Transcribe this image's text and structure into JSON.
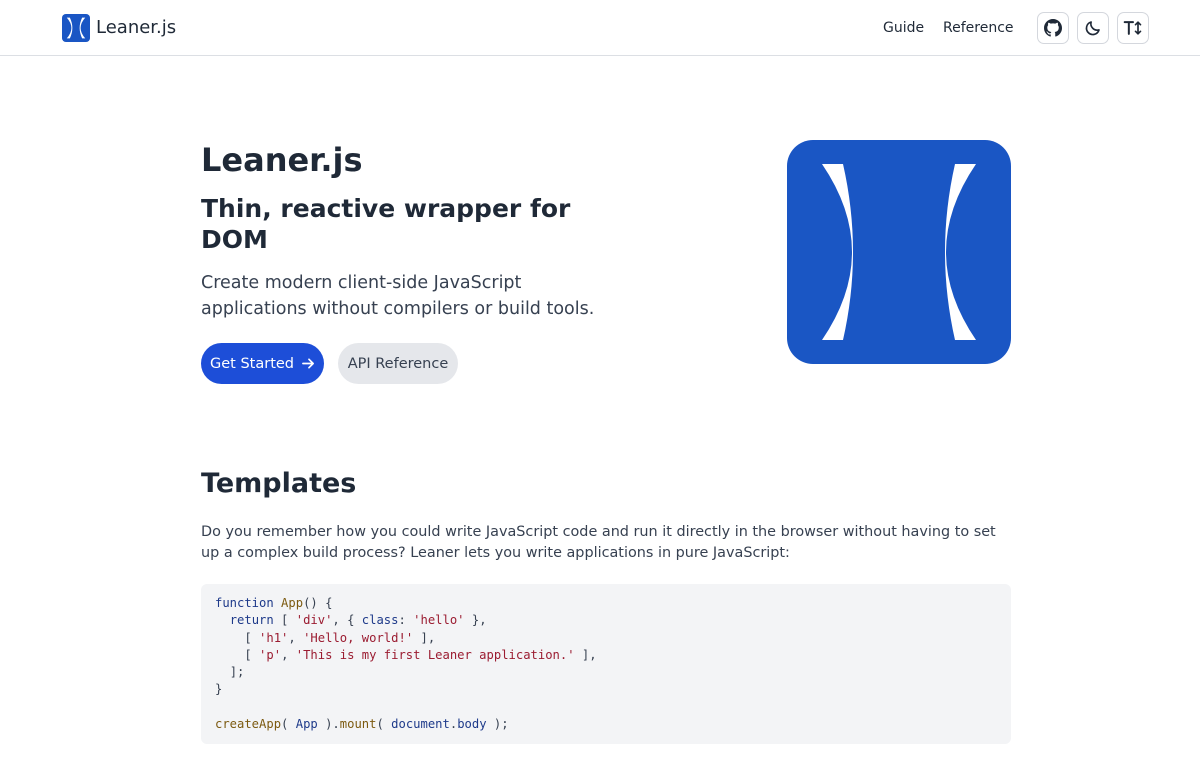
{
  "header": {
    "brand": "Leaner.js",
    "nav": [
      {
        "label": "Guide"
      },
      {
        "label": "Reference"
      }
    ],
    "icons": [
      "github-icon",
      "moon-icon",
      "text-size-icon"
    ]
  },
  "hero": {
    "title": "Leaner.js",
    "subtitle": "Thin, reactive wrapper for DOM",
    "description": "Create modern client-side JavaScript applications without compilers or build tools.",
    "primary_button": "Get Started",
    "secondary_button": "API Reference"
  },
  "templates": {
    "title": "Templates",
    "paragraph": "Do you remember how you could write JavaScript code and run it directly in the browser without having to set up a complex build process? Leaner lets you write applications in pure JavaScript:",
    "code": {
      "line1_kw": "function",
      "line1_fn": "App",
      "line1_rest": "() {",
      "line2_kw": "return",
      "line2_a": " [ ",
      "line2_s1": "'div'",
      "line2_b": ", { ",
      "line2_prop": "class",
      "line2_c": ": ",
      "line2_s2": "'hello'",
      "line2_d": " },",
      "line3_a": "[ ",
      "line3_s1": "'h1'",
      "line3_b": ", ",
      "line3_s2": "'Hello, world!'",
      "line3_c": " ],",
      "line4_a": "[ ",
      "line4_s1": "'p'",
      "line4_b": ", ",
      "line4_s2": "'This is my first Leaner application.'",
      "line4_c": " ],",
      "line5": "];",
      "line6": "}",
      "line8_fn1": "createApp",
      "line8_a": "( ",
      "line8_arg": "App",
      "line8_b": " ).",
      "line8_fn2": "mount",
      "line8_c": "( ",
      "line8_obj": "document",
      "line8_d": ".",
      "line8_prop": "body",
      "line8_e": " );"
    }
  },
  "colors": {
    "accent": "#1d4ed8",
    "logo_blue": "#1a56c4",
    "code_bg": "#f3f4f6"
  }
}
